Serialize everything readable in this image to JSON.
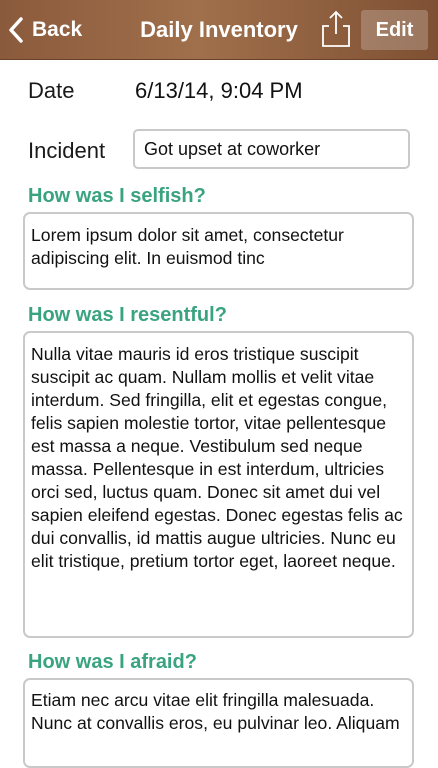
{
  "navbar": {
    "back_label": "Back",
    "title": "Daily Inventory",
    "edit_label": "Edit",
    "share_icon": "share-icon"
  },
  "form": {
    "date_label": "Date",
    "date_value": "6/13/14, 9:04 PM",
    "incident_label": "Incident",
    "incident_value": "Got upset at coworker"
  },
  "sections": {
    "selfish": {
      "heading": "How was I selfish?",
      "text": "Lorem ipsum dolor sit amet, consectetur adipiscing elit. In euismod tinc"
    },
    "resentful": {
      "heading": "How was I resentful?",
      "text": "Nulla vitae mauris id eros tristique suscipit suscipit ac quam. Nullam mollis et velit vitae interdum. Sed fringilla, elit et egestas congue, felis sapien molestie tortor, vitae pellentesque est massa a neque. Vestibulum sed neque massa. Pellentesque in est interdum, ultricies orci sed, luctus quam. Donec sit amet dui vel sapien eleifend egestas. Donec egestas felis ac dui convallis, id mattis augue ultricies. Nunc eu elit tristique, pretium tortor eget, laoreet neque."
    },
    "afraid": {
      "heading": "How was I afraid?",
      "text": "Etiam nec arcu vitae elit fringilla malesuada. Nunc at convallis eros, eu pulvinar leo. Aliquam"
    }
  },
  "colors": {
    "navbar_brown": "#8a5a3c",
    "heading_green": "#3aa37f",
    "field_border": "#c9c9c9"
  }
}
